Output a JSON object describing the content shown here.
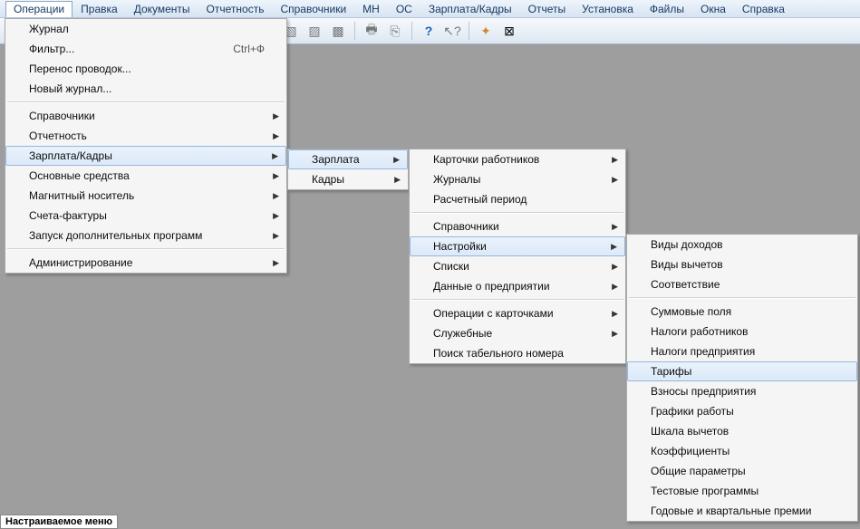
{
  "menubar": {
    "items": [
      "Операции",
      "Правка",
      "Документы",
      "Отчетность",
      "Справочники",
      "МН",
      "ОС",
      "Зарплата/Кадры",
      "Отчеты",
      "Установка",
      "Файлы",
      "Окна",
      "Справка"
    ]
  },
  "menu1": {
    "items": [
      {
        "label": "Журнал"
      },
      {
        "label": "Фильтр...",
        "accel": "Ctrl+Ф"
      },
      {
        "label": "Перенос проводок..."
      },
      {
        "label": "Новый журнал..."
      }
    ],
    "items2": [
      {
        "label": "Справочники",
        "sub": true
      },
      {
        "label": "Отчетность",
        "sub": true
      },
      {
        "label": "Зарплата/Кадры",
        "sub": true,
        "hl": true
      },
      {
        "label": "Основные средства",
        "sub": true
      },
      {
        "label": "Магнитный носитель",
        "sub": true
      },
      {
        "label": "Счета-фактуры",
        "sub": true
      },
      {
        "label": "Запуск дополнительных программ",
        "sub": true
      }
    ],
    "items3": [
      {
        "label": "Администрирование",
        "sub": true
      }
    ]
  },
  "menu2": {
    "items": [
      {
        "label": "Зарплата",
        "sub": true,
        "hl": true
      },
      {
        "label": "Кадры",
        "sub": true
      }
    ]
  },
  "menu3": {
    "g1": [
      {
        "label": "Карточки работников",
        "sub": true
      },
      {
        "label": "Журналы",
        "sub": true
      },
      {
        "label": "Расчетный период"
      }
    ],
    "g2": [
      {
        "label": "Справочники",
        "sub": true
      },
      {
        "label": "Настройки",
        "sub": true,
        "hl": true
      },
      {
        "label": "Списки",
        "sub": true
      },
      {
        "label": "Данные о предприятии",
        "sub": true
      }
    ],
    "g3": [
      {
        "label": "Операции с карточками",
        "sub": true
      },
      {
        "label": "Служебные",
        "sub": true
      },
      {
        "label": "Поиск табельного номера"
      }
    ]
  },
  "menu4": {
    "g1": [
      {
        "label": "Виды доходов"
      },
      {
        "label": "Виды вычетов"
      },
      {
        "label": "Соответствие"
      }
    ],
    "g2": [
      {
        "label": "Суммовые поля"
      },
      {
        "label": "Налоги работников"
      },
      {
        "label": "Налоги предприятия"
      },
      {
        "label": "Тарифы",
        "hl": true
      },
      {
        "label": "Взносы предприятия"
      },
      {
        "label": "Графики работы"
      },
      {
        "label": "Шкала вычетов"
      },
      {
        "label": "Коэффициенты"
      },
      {
        "label": "Общие параметры"
      },
      {
        "label": "Тестовые программы"
      },
      {
        "label": "Годовые и квартальные премии"
      }
    ]
  },
  "status": {
    "text": "Настраиваемое меню"
  },
  "toolbar_icons": [
    "◧",
    "◪",
    "≣",
    "⌕",
    "⎘",
    "│",
    "↻",
    "│",
    "⌚",
    "▦",
    "│",
    "📁",
    "💾",
    "│",
    "▤",
    "▥",
    "▦",
    "│",
    "🖶",
    "⎘",
    "│",
    "?",
    "↖?",
    "│",
    "✦",
    "⊠"
  ]
}
